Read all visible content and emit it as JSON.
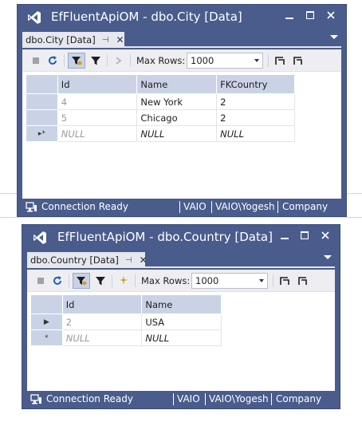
{
  "windows": [
    {
      "title": "EfFluentApiOM - dbo.City [Data]",
      "tab_label": "dbo.City [Data]",
      "max_rows_label": "Max Rows:",
      "max_rows_value": "1000",
      "columns": [
        "Id",
        "Name",
        "FKCountry"
      ],
      "rows": [
        [
          "4",
          "New York",
          "2"
        ],
        [
          "5",
          "Chicago",
          "2"
        ],
        [
          "NULL",
          "NULL",
          "NULL"
        ]
      ],
      "status": {
        "connection": "Connection Ready",
        "server": "VAIO",
        "user": "VAIO\\Yogesh",
        "database": "Company"
      }
    },
    {
      "title": "EfFluentApiOM - dbo.Country [Data]",
      "tab_label": "dbo.Country [Data]",
      "max_rows_label": "Max Rows:",
      "max_rows_value": "1000",
      "columns": [
        "Id",
        "Name"
      ],
      "rows": [
        [
          "2",
          "USA"
        ],
        [
          "NULL",
          "NULL"
        ]
      ],
      "status": {
        "connection": "Connection Ready",
        "server": "VAIO",
        "user": "VAIO\\Yogesh",
        "database": "Company"
      }
    }
  ],
  "colors": {
    "window_frame": "#4a5c8c",
    "header_cell": "#cad3e6",
    "toolbar": "#eeeef2"
  }
}
